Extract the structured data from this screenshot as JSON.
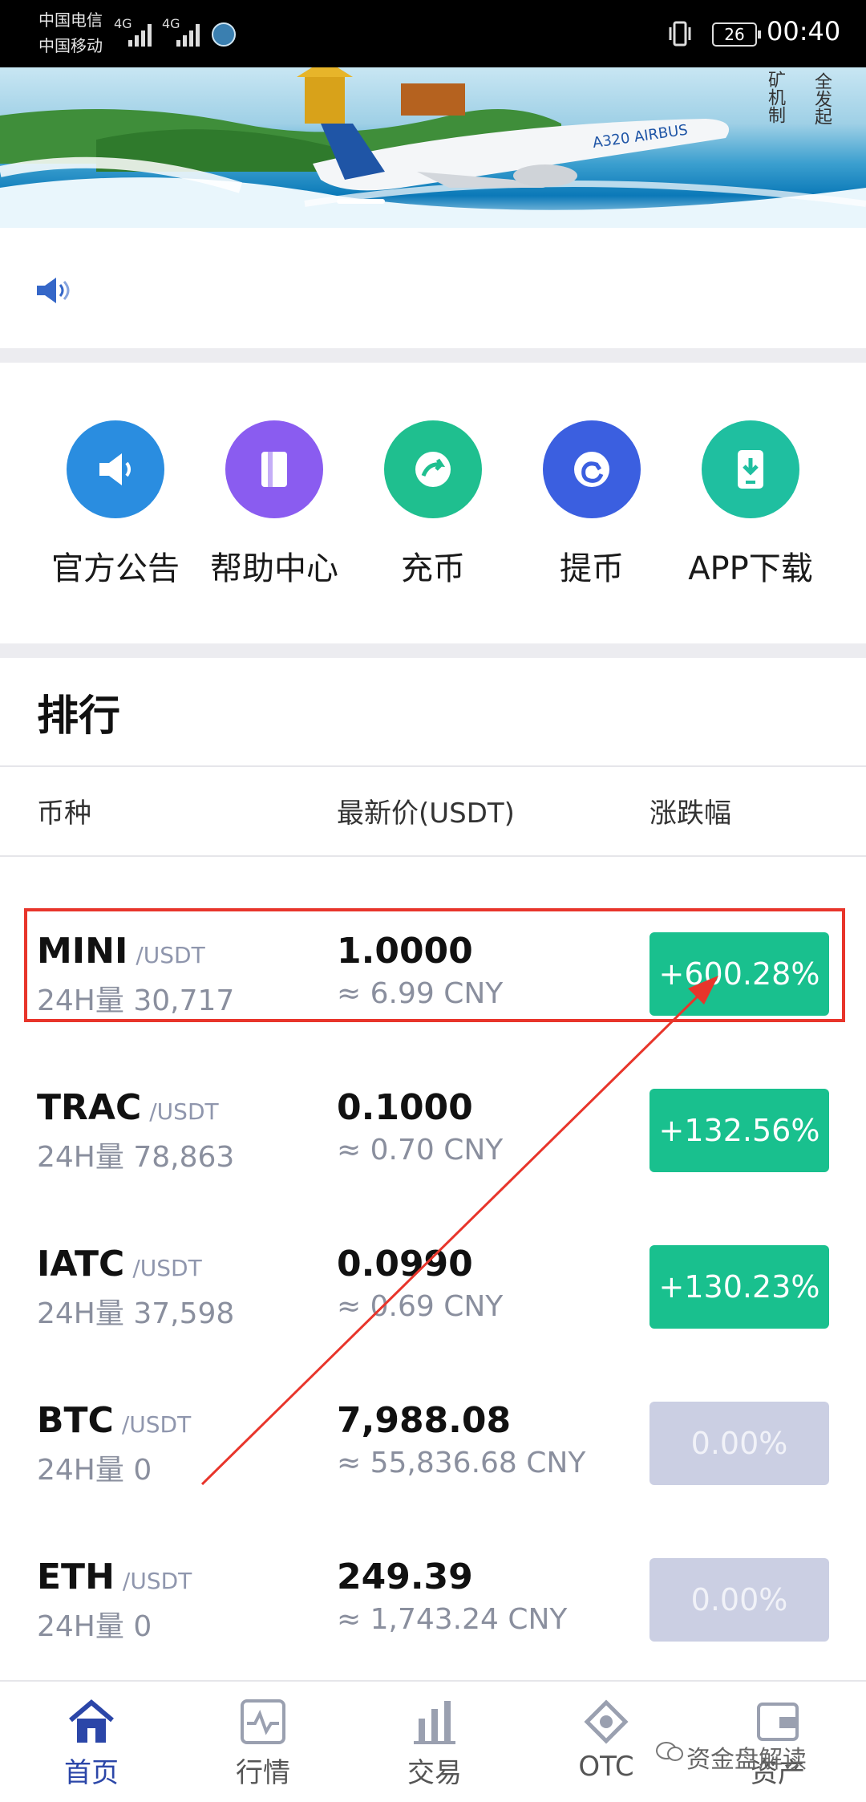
{
  "status_bar": {
    "carrier1": "中国电信",
    "carrier2": "中国移动",
    "net1": "4G",
    "net2": "4G",
    "battery": "26",
    "time": "00:40"
  },
  "banner": {
    "text_col1": "全发起",
    "text_col2": "矿机制"
  },
  "menu": [
    {
      "label": "官方公告",
      "icon": "megaphone-icon",
      "color": "#2a8de0"
    },
    {
      "label": "帮助中心",
      "icon": "book-icon",
      "color": "#8a5cf0"
    },
    {
      "label": "充币",
      "icon": "deposit-icon",
      "color": "#1fbf8f"
    },
    {
      "label": "提币",
      "icon": "withdraw-icon",
      "color": "#3b5fe0"
    },
    {
      "label": "APP下载",
      "icon": "app-download-icon",
      "color": "#1fbfa0"
    }
  ],
  "ranking": {
    "title": "排行",
    "headers": {
      "coin": "币种",
      "price": "最新价(USDT)",
      "change": "涨跌幅"
    },
    "rows": [
      {
        "symbol": "MINI",
        "pair": "/USDT",
        "volume": "24H量 30,717",
        "price": "1.0000",
        "cny": "≈ 6.99 CNY",
        "change": "+600.28%",
        "trend": "up"
      },
      {
        "symbol": "TRAC",
        "pair": "/USDT",
        "volume": "24H量 78,863",
        "price": "0.1000",
        "cny": "≈ 0.70 CNY",
        "change": "+132.56%",
        "trend": "up"
      },
      {
        "symbol": "IATC",
        "pair": "/USDT",
        "volume": "24H量 37,598",
        "price": "0.0990",
        "cny": "≈ 0.69 CNY",
        "change": "+130.23%",
        "trend": "up"
      },
      {
        "symbol": "BTC",
        "pair": "/USDT",
        "volume": "24H量 0",
        "price": "7,988.08",
        "cny": "≈ 55,836.68 CNY",
        "change": "0.00%",
        "trend": "flat"
      },
      {
        "symbol": "ETH",
        "pair": "/USDT",
        "volume": "24H量 0",
        "price": "249.39",
        "cny": "≈ 1,743.24 CNY",
        "change": "0.00%",
        "trend": "flat"
      }
    ]
  },
  "tabs": [
    {
      "label": "首页",
      "icon": "home-icon",
      "active": true
    },
    {
      "label": "行情",
      "icon": "market-icon",
      "active": false
    },
    {
      "label": "交易",
      "icon": "trade-icon",
      "active": false
    },
    {
      "label": "OTC",
      "icon": "otc-icon",
      "active": false
    },
    {
      "label": "资产",
      "icon": "wallet-icon",
      "active": false
    }
  ],
  "watermark": "资金盘解读",
  "colors": {
    "up": "#19c08e",
    "flat": "#cbcfe3",
    "active_tab": "#2b46a8",
    "highlight": "#e8352b"
  }
}
